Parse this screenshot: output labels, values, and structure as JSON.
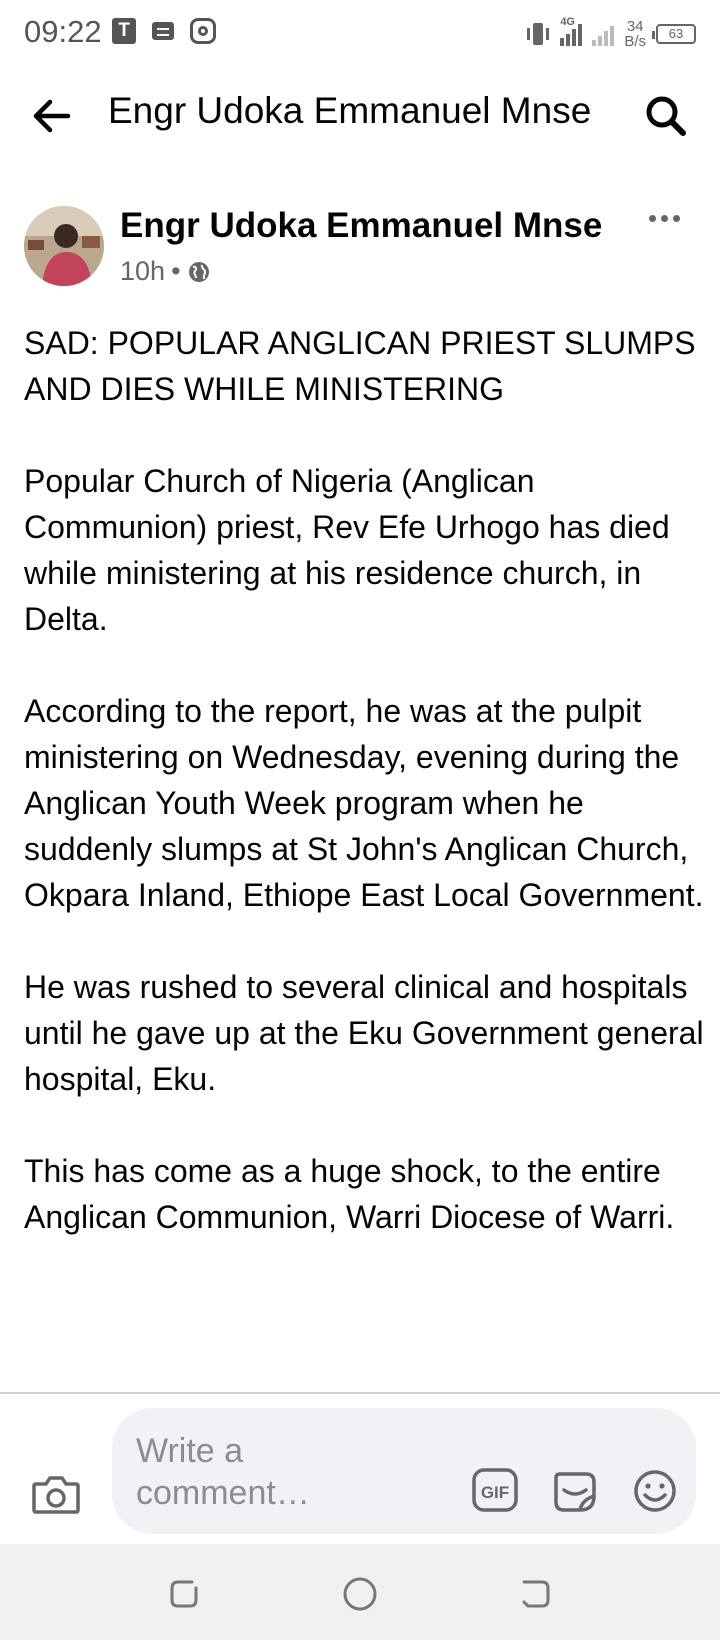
{
  "status_bar": {
    "time": "09:22",
    "notif_t": "T",
    "network_tag": "4G",
    "net_speed_value": "34",
    "net_speed_unit": "B/s",
    "battery": "63"
  },
  "header": {
    "title": "Engr Udoka Emmanuel Mnse"
  },
  "post": {
    "author": "Engr Udoka Emmanuel Mnse",
    "time_ago": "10h",
    "separator": "•",
    "paragraphs": [
      "SAD: POPULAR ANGLICAN PRIEST SLUMPS AND DIES WHILE MINISTERING",
      "Popular Church of Nigeria (Anglican Communion) priest, Rev Efe Urhogo has died while ministering at his residence church, in Delta.",
      "According to the report, he was at the pulpit ministering on Wednesday, evening during the Anglican Youth Week program when he suddenly slumps at St John's Anglican Church, Okpara Inland, Ethiope East Local Government.",
      "He was rushed to several clinical and hospitals until he gave up at the Eku Government general hospital, Eku.",
      "This has come as a huge shock, to the entire Anglican Communion, Warri Diocese of Warri."
    ]
  },
  "comment_bar": {
    "placeholder": "Write a comment…",
    "gif_label": "GIF"
  },
  "colors": {
    "text": "#050505",
    "secondary": "#65676b",
    "input_bg": "#f0f2f5"
  }
}
